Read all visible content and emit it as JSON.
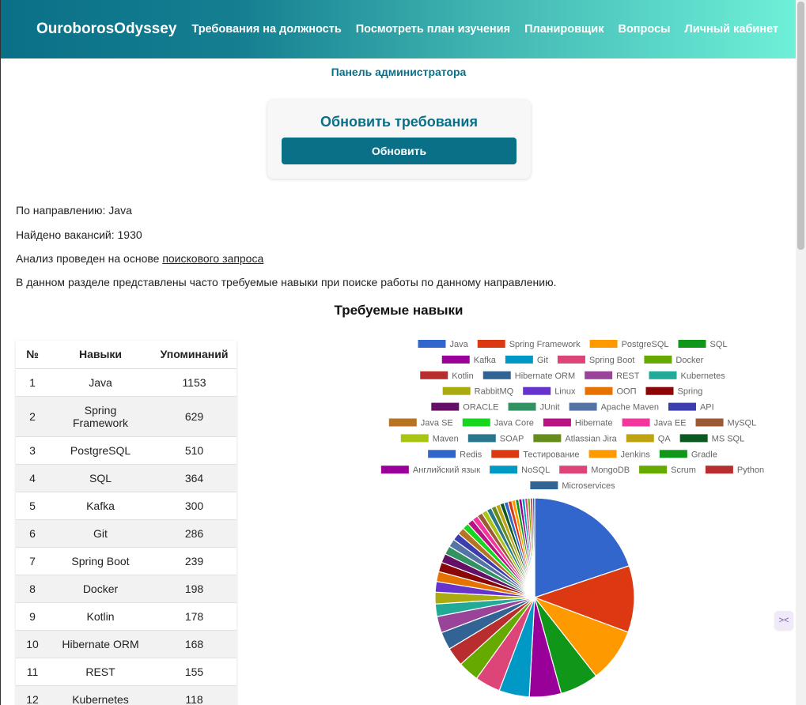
{
  "header": {
    "brand": "OuroborosOdyssey",
    "nav": [
      "Требования на должность",
      "Посмотреть план изучения",
      "Планировщик",
      "Вопросы",
      "Личный кабинет"
    ]
  },
  "admin_link": "Панель администратора",
  "update_card": {
    "title": "Обновить требования",
    "button": "Обновить"
  },
  "info": {
    "direction": "По направлению: Java",
    "vacancies": "Найдено вакансий: 1930",
    "analysis_prefix": "Анализ проведен на основе ",
    "analysis_link": "поискового запроса",
    "description": "В данном разделе представлены часто требуемые навыки при поиске работы по данному направлению."
  },
  "section_title": "Требуемые навыки",
  "table": {
    "headers": [
      "№",
      "Навыки",
      "Упоминаний"
    ],
    "rows": [
      {
        "n": "1",
        "skill": "Java",
        "count": "1153"
      },
      {
        "n": "2",
        "skill": "Spring Framework",
        "count": "629"
      },
      {
        "n": "3",
        "skill": "PostgreSQL",
        "count": "510"
      },
      {
        "n": "4",
        "skill": "SQL",
        "count": "364"
      },
      {
        "n": "5",
        "skill": "Kafka",
        "count": "300"
      },
      {
        "n": "6",
        "skill": "Git",
        "count": "286"
      },
      {
        "n": "7",
        "skill": "Spring Boot",
        "count": "239"
      },
      {
        "n": "8",
        "skill": "Docker",
        "count": "198"
      },
      {
        "n": "9",
        "skill": "Kotlin",
        "count": "178"
      },
      {
        "n": "10",
        "skill": "Hibernate ORM",
        "count": "168"
      },
      {
        "n": "11",
        "skill": "REST",
        "count": "155"
      },
      {
        "n": "12",
        "skill": "Kubernetes",
        "count": "118"
      }
    ]
  },
  "chart_data": {
    "type": "pie",
    "title": "",
    "legend_position": "top",
    "categories": [
      "Java",
      "Spring Framework",
      "PostgreSQL",
      "SQL",
      "Kafka",
      "Git",
      "Spring Boot",
      "Docker",
      "Kotlin",
      "Hibernate ORM",
      "REST",
      "Kubernetes",
      "RabbitMQ",
      "Linux",
      "ООП",
      "Spring",
      "ORACLE",
      "JUnit",
      "Apache Maven",
      "API",
      "Java SE",
      "Java Core",
      "Hibernate",
      "Java EE",
      "MySQL",
      "Maven",
      "SOAP",
      "Atlassian Jira",
      "QA",
      "MS SQL",
      "Redis",
      "Тестирование",
      "Jenkins",
      "Gradle",
      "Английский язык",
      "NoSQL",
      "MongoDB",
      "Scrum",
      "Python",
      "Microservices"
    ],
    "values": [
      1153,
      629,
      510,
      364,
      300,
      286,
      239,
      198,
      178,
      168,
      155,
      118,
      110,
      100,
      95,
      90,
      85,
      80,
      75,
      70,
      66,
      62,
      58,
      55,
      52,
      50,
      48,
      45,
      42,
      40,
      38,
      36,
      34,
      32,
      30,
      28,
      26,
      24,
      22,
      20
    ],
    "colors": [
      "#3366cc",
      "#dc3912",
      "#ff9900",
      "#109618",
      "#990099",
      "#0099c6",
      "#dd4477",
      "#66aa00",
      "#b82e2e",
      "#316395",
      "#994499",
      "#22aa99",
      "#aaaa11",
      "#6633cc",
      "#e67300",
      "#8b0707",
      "#651067",
      "#329262",
      "#5574a6",
      "#3b3eac",
      "#b77322",
      "#16d620",
      "#b91383",
      "#f4359e",
      "#9c5935",
      "#a9c413",
      "#2a778d",
      "#668d1c",
      "#bea413",
      "#0c5922",
      "#3366cc",
      "#dc3912",
      "#ff9900",
      "#109618",
      "#990099",
      "#0099c6",
      "#dd4477",
      "#66aa00",
      "#b82e2e",
      "#316395"
    ]
  },
  "side_button_icon": "code-icon"
}
